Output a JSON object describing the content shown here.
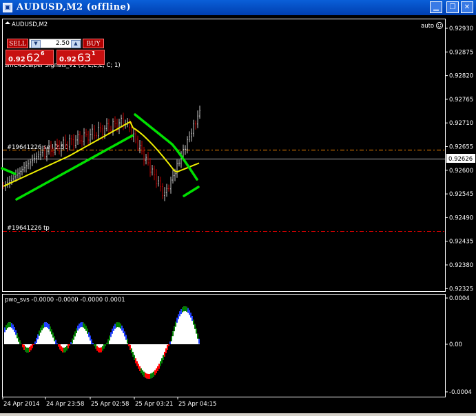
{
  "window": {
    "title": "AUDUSD,M2 (offline)"
  },
  "chart": {
    "symbol_label": "AUDUSD,M2",
    "auto_label": "auto",
    "indicator_label": "smC4Scalper Signals_v1 (3, E,E,E, C; 1)",
    "sell_line_label": "#19641226 sell 2.50",
    "tp_line_label": "#19641226 tp",
    "current_price": "0.92626",
    "price_axis": [
      "0.92930",
      "0.92875",
      "0.92820",
      "0.92765",
      "0.92710",
      "0.92655",
      "0.92600",
      "0.92545",
      "0.92490",
      "0.92435",
      "0.92380",
      "0.92325"
    ],
    "sub_label": "pwo_svs -0.0000 -0.0000 -0.0000 0.0001",
    "sub_axis": [
      "0.0004",
      "0.00",
      "-0.0004"
    ],
    "time_axis": [
      "24 Apr 2014",
      "24 Apr 23:58",
      "25 Apr 02:58",
      "25 Apr 03:21",
      "25 Apr 04:15"
    ]
  },
  "trade_panel": {
    "sell_label": "SELL",
    "buy_label": "BUY",
    "lot": "2.50",
    "sell_price": {
      "prefix": "0.92",
      "big": "62",
      "sup": "6"
    },
    "buy_price": {
      "prefix": "0.92",
      "big": "63",
      "sup": "1"
    }
  },
  "colors": {
    "up_bar": "#c8c8c8",
    "down_bar": "#c00000",
    "ma": "#f0f000",
    "band": "#00e000",
    "sell_line": "#ff8c00",
    "tp_line": "#d00000",
    "hist_white": "#ffffff",
    "hist_blue": "#2040ff",
    "hist_red": "#ff0000",
    "hist_green": "#008000"
  }
}
